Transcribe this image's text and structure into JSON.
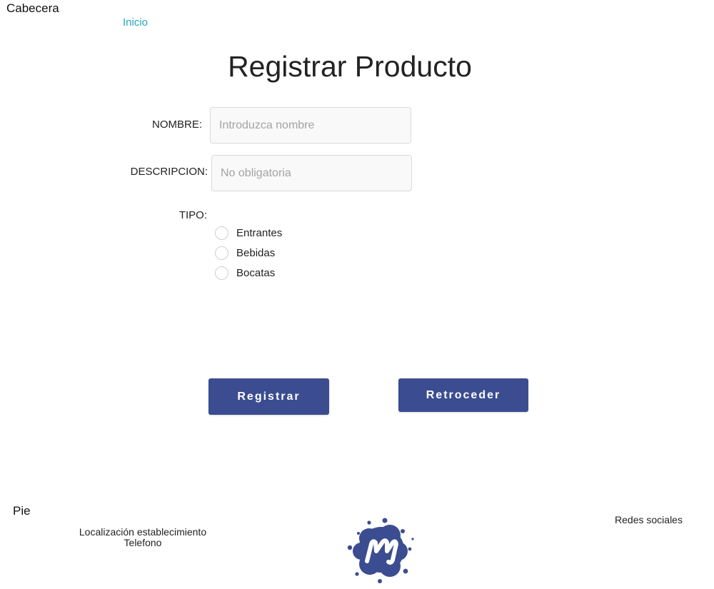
{
  "header": {
    "label": "Cabecera",
    "nav_link": "Inicio"
  },
  "page_title": "Registrar Producto",
  "form": {
    "nombre": {
      "label": "NOMBRE:",
      "placeholder": "Introduzca nombre",
      "value": ""
    },
    "descripcion": {
      "label": "DESCRIPCION:",
      "placeholder": "No obligatoria",
      "value": ""
    },
    "tipo": {
      "label": "TIPO:",
      "options": [
        "Entrantes",
        "Bebidas",
        "Bocatas"
      ],
      "selected": null
    }
  },
  "buttons": {
    "registrar": "Registrar",
    "retroceder": "Retroceder"
  },
  "footer": {
    "label": "Pie",
    "location": "Localización establecimiento",
    "phone": "Telefono",
    "social": "Redes sociales",
    "logo_icon": "meetup-logo-icon"
  },
  "colors": {
    "accent_link": "#2aa3bd",
    "button_bg": "#3b4d90",
    "logo": "#3b4d90"
  }
}
